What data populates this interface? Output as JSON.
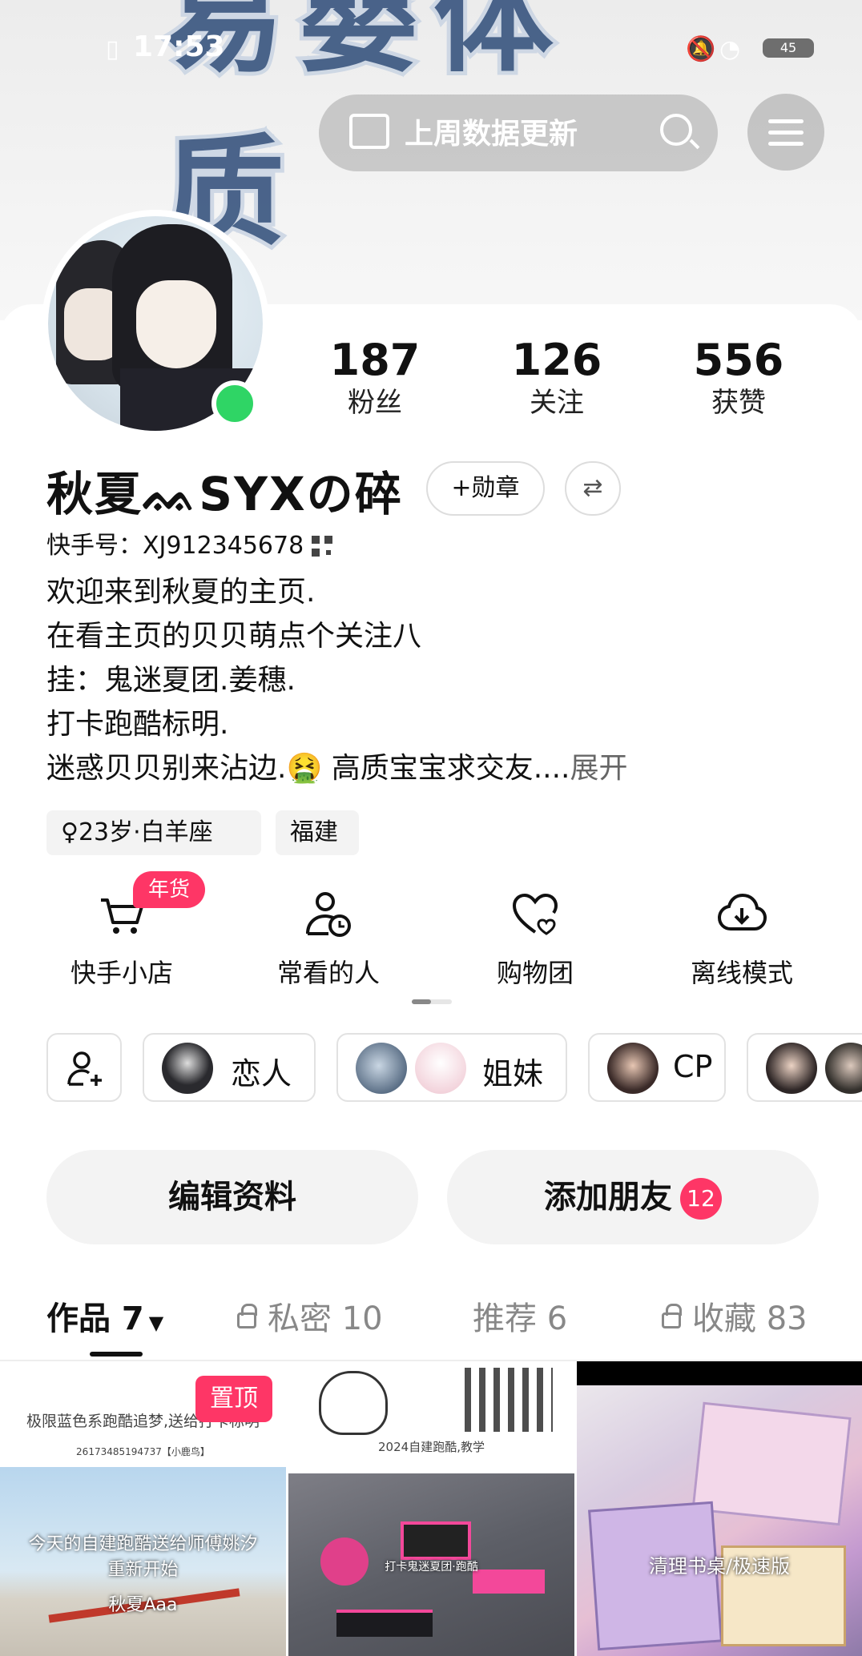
{
  "status_bar": {
    "time": "17:53",
    "battery": "45"
  },
  "header": {
    "banner_text": "易嬰体质",
    "notice_label": "上周数据更新"
  },
  "profile": {
    "stats": [
      {
        "value": "187",
        "label": "粉丝"
      },
      {
        "value": "126",
        "label": "关注"
      },
      {
        "value": "556",
        "label": "获赞"
      }
    ],
    "name": "秋夏ᨐSYXの碎",
    "badge_button": "+勋章",
    "switch_icon": "⇄",
    "kwai_id": "快手号：XJ912345678",
    "bio_lines": [
      "欢迎来到秋夏的主页.",
      "在看主页的贝贝萌点个关注八",
      "挂：鬼迷夏团.姜穗.",
      "打卡跑酷标明.",
      "迷惑贝贝别来沾边.🤮 高质宝宝求交友...."
    ],
    "bio_expand": "展开",
    "tags": [
      "♀23岁·白羊座",
      "福建"
    ]
  },
  "shortcuts": [
    {
      "label": "快手小店",
      "icon": "cart-icon",
      "badge": "年货"
    },
    {
      "label": "常看的人",
      "icon": "person-clock-icon"
    },
    {
      "label": "购物团",
      "icon": "heart-group-icon"
    },
    {
      "label": "离线模式",
      "icon": "cloud-download-icon"
    }
  ],
  "relations": {
    "add_icon": "add-friend-icon",
    "items": [
      {
        "label": "恋人"
      },
      {
        "label": "姐妹"
      },
      {
        "label": "CP"
      }
    ]
  },
  "actions": {
    "edit_profile": "编辑资料",
    "add_friend": "添加朋友",
    "add_friend_count": "12"
  },
  "tabs": [
    {
      "label": "作品 7",
      "active": true,
      "locked": false
    },
    {
      "label": "私密 10",
      "active": false,
      "locked": true
    },
    {
      "label": "推荐 6",
      "active": false,
      "locked": false
    },
    {
      "label": "收藏 83",
      "active": false,
      "locked": true
    }
  ],
  "posts": [
    {
      "pin_label": "置顶",
      "caption_top": "极限蓝色系跑酷追梦,送给打卡标明",
      "caption_code": "26173485194737【小鹿鸟】",
      "overlay_text": "今天的自建跑酷送给师傅姚汐\n重新开始",
      "author": "秋夏Aaa"
    },
    {
      "caption_top": "2024自建跑酷,教学",
      "overlay_text": "打卡鬼迷夏团·跑酷"
    },
    {
      "overlay_text": "清理书桌/极速版"
    }
  ],
  "colors": {
    "accent": "#fe3666",
    "online": "#2fd565",
    "banner": "#2d4b78"
  }
}
